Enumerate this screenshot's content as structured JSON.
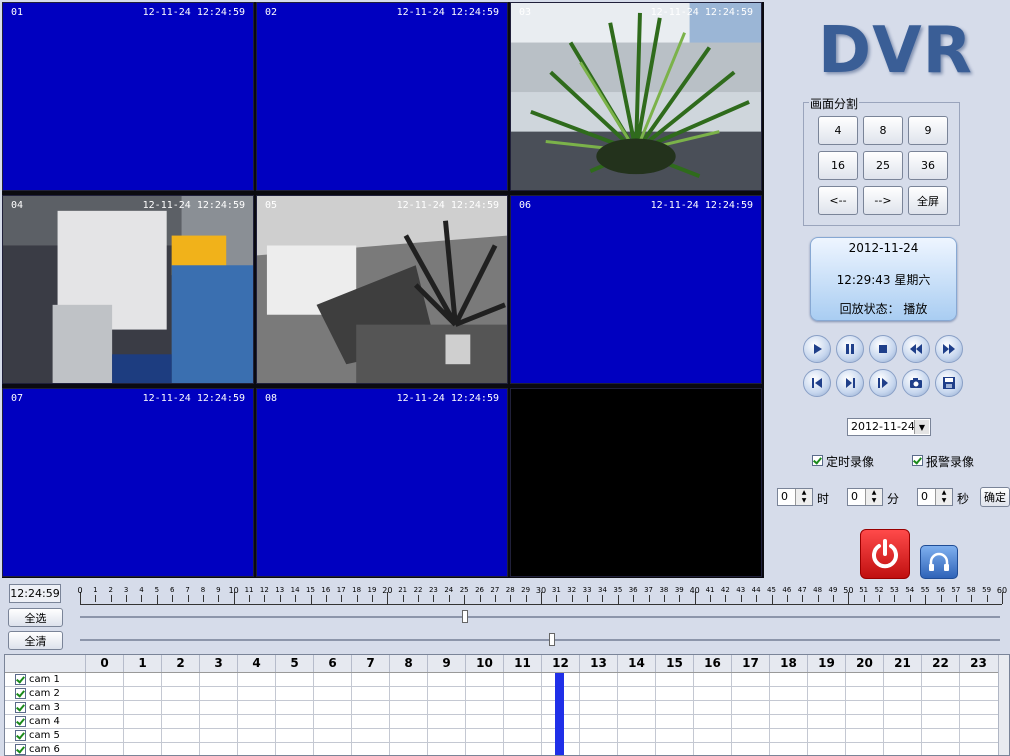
{
  "logo": "DVR",
  "cameras": [
    {
      "num": "01",
      "ts": "12-11-24 12:24:59",
      "state": "blue"
    },
    {
      "num": "02",
      "ts": "12-11-24 12:24:59",
      "state": "blue"
    },
    {
      "num": "03",
      "ts": "12-11-24 12:24:59",
      "state": "feed-plant"
    },
    {
      "num": "04",
      "ts": "12-11-24 12:24:59",
      "state": "feed-office"
    },
    {
      "num": "05",
      "ts": "12-11-24 12:24:59",
      "state": "feed-room"
    },
    {
      "num": "06",
      "ts": "12-11-24 12:24:59",
      "state": "blue"
    },
    {
      "num": "07",
      "ts": "12-11-24 12:24:59",
      "state": "blue"
    },
    {
      "num": "08",
      "ts": "12-11-24 12:24:59",
      "state": "blue"
    },
    {
      "num": "",
      "ts": "",
      "state": "black"
    }
  ],
  "split": {
    "title": "画面分割",
    "buttons": [
      "4",
      "8",
      "9",
      "16",
      "25",
      "36",
      "<--",
      "-->",
      "全屏"
    ]
  },
  "info": {
    "date": "2012-11-24",
    "time": "12:29:43  星期六",
    "status": "回放状态：  播放"
  },
  "controls": {
    "row1": [
      "play-icon",
      "pause-icon",
      "stop-icon",
      "rewind-icon",
      "fast-forward-icon"
    ],
    "row2": [
      "skip-back-icon",
      "step-forward-icon",
      "frame-forward-icon",
      "snapshot-icon",
      "save-icon"
    ]
  },
  "date_select": "2012-11-24",
  "checks": {
    "timed": "定时录像",
    "alarm": "报警录像"
  },
  "time_input": {
    "hour": "0",
    "hour_label": "时",
    "minute": "0",
    "minute_label": "分",
    "second": "0",
    "second_label": "秒",
    "ok": "确定"
  },
  "timeline": {
    "current": "12:24:59",
    "ruler_max": 60,
    "select_all": "全选",
    "clear_all": "全清",
    "slider1": 0.415,
    "slider2": 0.51
  },
  "schedule": {
    "hours": [
      "0",
      "1",
      "2",
      "3",
      "4",
      "5",
      "6",
      "7",
      "8",
      "9",
      "10",
      "11",
      "12",
      "13",
      "14",
      "15",
      "16",
      "17",
      "18",
      "19",
      "20",
      "21",
      "22",
      "23"
    ],
    "rows": [
      "cam 1",
      "cam 2",
      "cam 3",
      "cam 4",
      "cam 5",
      "cam 6"
    ],
    "recorded_hour": 12
  },
  "colors": {
    "blank_feed": "#0000c0",
    "recorded": "#1f2fe8",
    "power": "#e02020",
    "accent": "#3a5e96"
  }
}
